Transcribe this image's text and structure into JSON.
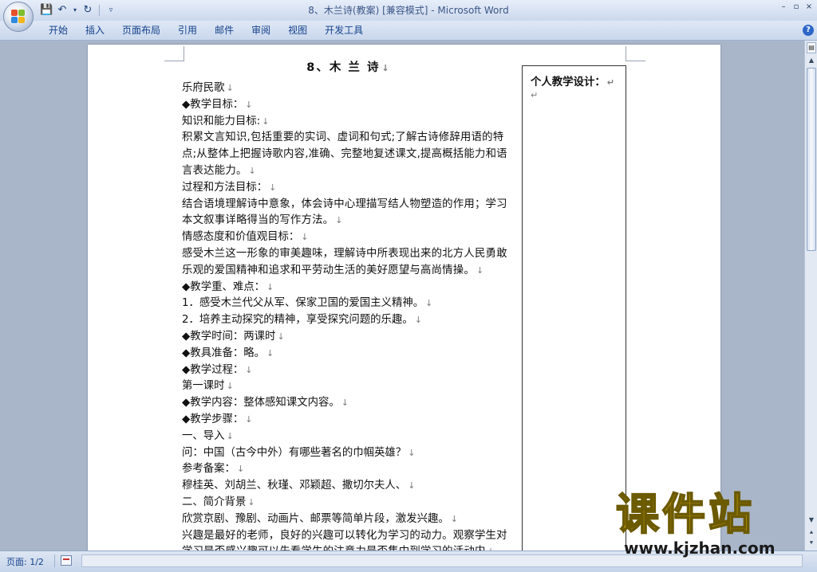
{
  "window": {
    "title": "8、木兰诗(教案) [兼容模式] - Microsoft Word",
    "controls": [
      "–",
      "▫",
      "×"
    ]
  },
  "ribbon": {
    "tabs": [
      "开始",
      "插入",
      "页面布局",
      "引用",
      "邮件",
      "审阅",
      "视图",
      "开发工具"
    ],
    "help": "?"
  },
  "document": {
    "title": "8、木 兰 诗",
    "paragraph_mark": "↓",
    "lines": [
      {
        "text": "乐府民歌",
        "wrap": false
      },
      {
        "text": "◆教学目标：",
        "wrap": false
      },
      {
        "text": "知识和能力目标:",
        "wrap": false
      },
      {
        "text": "积累文言知识,包括重要的实词、虚词和句式;了解古诗修辞用语的特点;从整体上把握诗歌内容,准确、完整地复述课文,提高概括能力和语言表达能力。",
        "wrap": true
      },
      {
        "text": "过程和方法目标：",
        "wrap": false
      },
      {
        "text": "结合语境理解诗中意象，体会诗中心理描写结人物塑造的作用；学习本文叙事详略得当的写作方法。",
        "wrap": true
      },
      {
        "text": "情感态度和价值观目标：",
        "wrap": false
      },
      {
        "text": "感受木兰这一形象的审美趣味，理解诗中所表现出来的北方人民勇敢乐观的爱国精神和追求和平劳动生活的美好愿望与高尚情操。",
        "wrap": true
      },
      {
        "text": "◆教学重、难点：",
        "wrap": false
      },
      {
        "text": "1．感受木兰代父从军、保家卫国的爱国主义精神。",
        "wrap": false
      },
      {
        "text": "2．培养主动探究的精神，享受探究问题的乐趣。",
        "wrap": false
      },
      {
        "text": "◆教学时间：两课时",
        "wrap": false
      },
      {
        "text": "◆教具准备：略。",
        "wrap": false
      },
      {
        "text": "◆教学过程：",
        "wrap": false
      },
      {
        "text": "第一课时",
        "wrap": false
      },
      {
        "text": "◆教学内容：整体感知课文内容。",
        "wrap": false
      },
      {
        "text": "◆教学步骤：",
        "wrap": false
      },
      {
        "text": "一、导入",
        "wrap": false
      },
      {
        "text": "问：中国（古今中外）有哪些著名的巾帼英雄？",
        "wrap": false
      },
      {
        "text": "参考备案：",
        "wrap": false
      },
      {
        "text": "穆桂英、刘胡兰、秋瑾、邓颖超、撒切尔夫人、",
        "wrap": false
      },
      {
        "text": "二、简介背景",
        "wrap": false
      },
      {
        "text": "欣赏京剧、豫剧、动画片、邮票等简单片段，激发兴趣。",
        "wrap": false
      },
      {
        "text": "兴趣是最好的老师，良好的兴趣可以转化为学习的动力。观察学生对学习是否感兴趣可以先看学生的注意力是否集中到学习的活动内",
        "wrap": true
      }
    ],
    "side_box": {
      "title": "个人教学设计：",
      "mark": "↵"
    }
  },
  "status_bar": {
    "page": "页面: 1/2"
  },
  "watermark": {
    "text": "课件站",
    "url": "www.kjzhan.com"
  }
}
